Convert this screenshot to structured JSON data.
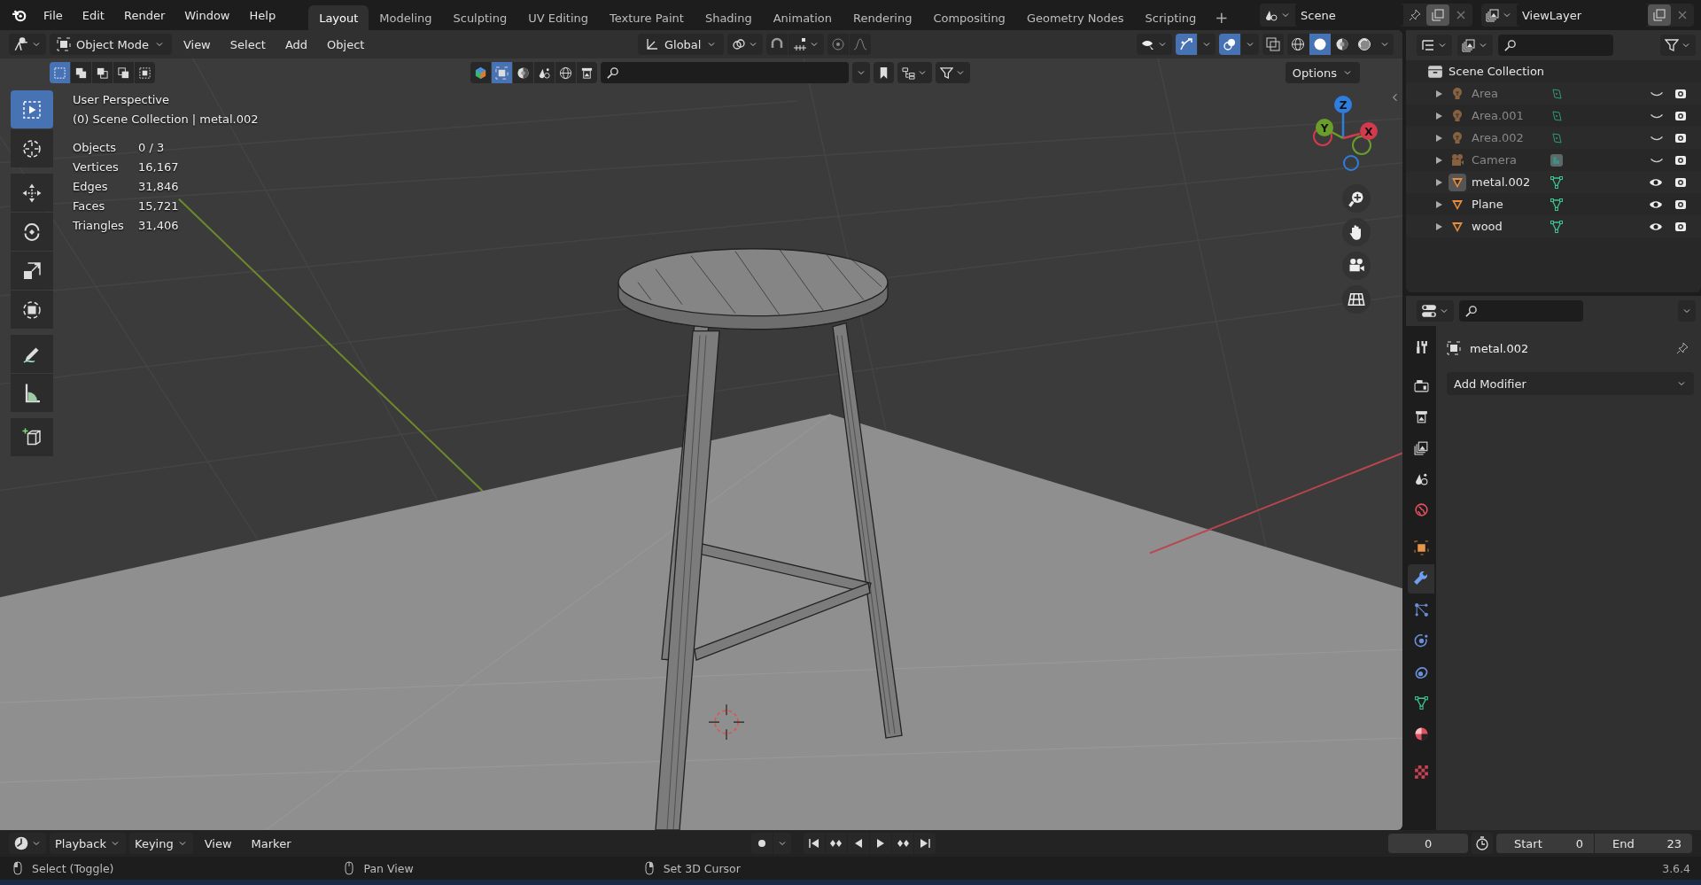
{
  "menu": [
    "File",
    "Edit",
    "Render",
    "Window",
    "Help"
  ],
  "workspaces": [
    {
      "label": "Layout",
      "selected": true
    },
    {
      "label": "Modeling",
      "selected": false
    },
    {
      "label": "Sculpting",
      "selected": false
    },
    {
      "label": "UV Editing",
      "selected": false
    },
    {
      "label": "Texture Paint",
      "selected": false
    },
    {
      "label": "Shading",
      "selected": false
    },
    {
      "label": "Animation",
      "selected": false
    },
    {
      "label": "Rendering",
      "selected": false
    },
    {
      "label": "Compositing",
      "selected": false
    },
    {
      "label": "Geometry Nodes",
      "selected": false
    },
    {
      "label": "Scripting",
      "selected": false
    }
  ],
  "add_workspace": "+",
  "scene": "Scene",
  "view_layer": "ViewLayer",
  "viewport": {
    "mode": "Object Mode",
    "menus": [
      "View",
      "Select",
      "Add",
      "Object"
    ],
    "orientation": "Global",
    "select_modes": [
      {
        "kind": "set",
        "selected": true
      },
      {
        "kind": "extend",
        "selected": false
      },
      {
        "kind": "subtract",
        "selected": false
      },
      {
        "kind": "invert",
        "selected": false
      },
      {
        "kind": "intersect",
        "selected": false
      }
    ],
    "shading": [
      {
        "kind": "wireframe",
        "selected": false
      },
      {
        "kind": "solid",
        "selected": true
      },
      {
        "kind": "material",
        "selected": false
      },
      {
        "kind": "rendered",
        "selected": false
      }
    ],
    "options": "Options",
    "view_name": "User Perspective",
    "context": "(0) Scene Collection | metal.002",
    "stats": [
      {
        "label": "Objects",
        "value": "0 / 3"
      },
      {
        "label": "Vertices",
        "value": "16,167"
      },
      {
        "label": "Edges",
        "value": "31,846"
      },
      {
        "label": "Faces",
        "value": "15,721"
      },
      {
        "label": "Triangles",
        "value": "31,406"
      }
    ],
    "tools": [
      {
        "kind": "select-box",
        "selected": true
      },
      {
        "kind": "cursor",
        "selected": false
      },
      {
        "kind": "move",
        "selected": false
      },
      {
        "kind": "rotate",
        "selected": false
      },
      {
        "kind": "scale",
        "selected": false
      },
      {
        "kind": "transform",
        "selected": false
      },
      {
        "kind": "annotate",
        "selected": false
      },
      {
        "kind": "measure",
        "selected": false
      },
      {
        "kind": "add-cube",
        "selected": false
      }
    ],
    "axes": [
      {
        "label": "Z",
        "color": "#2e7ee0"
      },
      {
        "label": "Y",
        "color": "#6a9e2a"
      },
      {
        "label": "X",
        "color": "#d33a4e"
      }
    ]
  },
  "outliner": {
    "root": "Scene Collection",
    "items": [
      {
        "name": "Area",
        "kind": "light",
        "visible": false,
        "active": false
      },
      {
        "name": "Area.001",
        "kind": "light",
        "visible": false,
        "active": false
      },
      {
        "name": "Area.002",
        "kind": "light",
        "visible": false,
        "active": false
      },
      {
        "name": "Camera",
        "kind": "camera",
        "visible": false,
        "active": false
      },
      {
        "name": "metal.002",
        "kind": "mesh",
        "visible": true,
        "active": true
      },
      {
        "name": "Plane",
        "kind": "mesh",
        "visible": true,
        "active": false
      },
      {
        "name": "wood",
        "kind": "mesh",
        "visible": true,
        "active": false
      }
    ]
  },
  "properties": {
    "tabs": [
      {
        "kind": "tool",
        "selected": false
      },
      {
        "kind": "render",
        "selected": false
      },
      {
        "kind": "output",
        "selected": false
      },
      {
        "kind": "view-layer",
        "selected": false
      },
      {
        "kind": "scene",
        "selected": false
      },
      {
        "kind": "world",
        "selected": false
      },
      {
        "kind": "object",
        "selected": false
      },
      {
        "kind": "modifiers",
        "selected": true
      },
      {
        "kind": "particles",
        "selected": false
      },
      {
        "kind": "physics",
        "selected": false
      },
      {
        "kind": "constraints",
        "selected": false
      },
      {
        "kind": "data",
        "selected": false
      },
      {
        "kind": "material",
        "selected": false
      },
      {
        "kind": "texture",
        "selected": false
      }
    ],
    "object": "metal.002",
    "add_modifier": "Add Modifier"
  },
  "timeline": {
    "menus": [
      {
        "label": "Playback",
        "dropdown": true
      },
      {
        "label": "Keying",
        "dropdown": true
      },
      {
        "label": "View",
        "dropdown": false
      },
      {
        "label": "Marker",
        "dropdown": false
      }
    ],
    "frame": "0",
    "start_label": "Start",
    "start": "0",
    "end_label": "End",
    "end": "23"
  },
  "status_bar": {
    "hints": [
      "Select (Toggle)",
      "Pan View",
      "Set 3D Cursor"
    ],
    "version": "3.6.4"
  }
}
